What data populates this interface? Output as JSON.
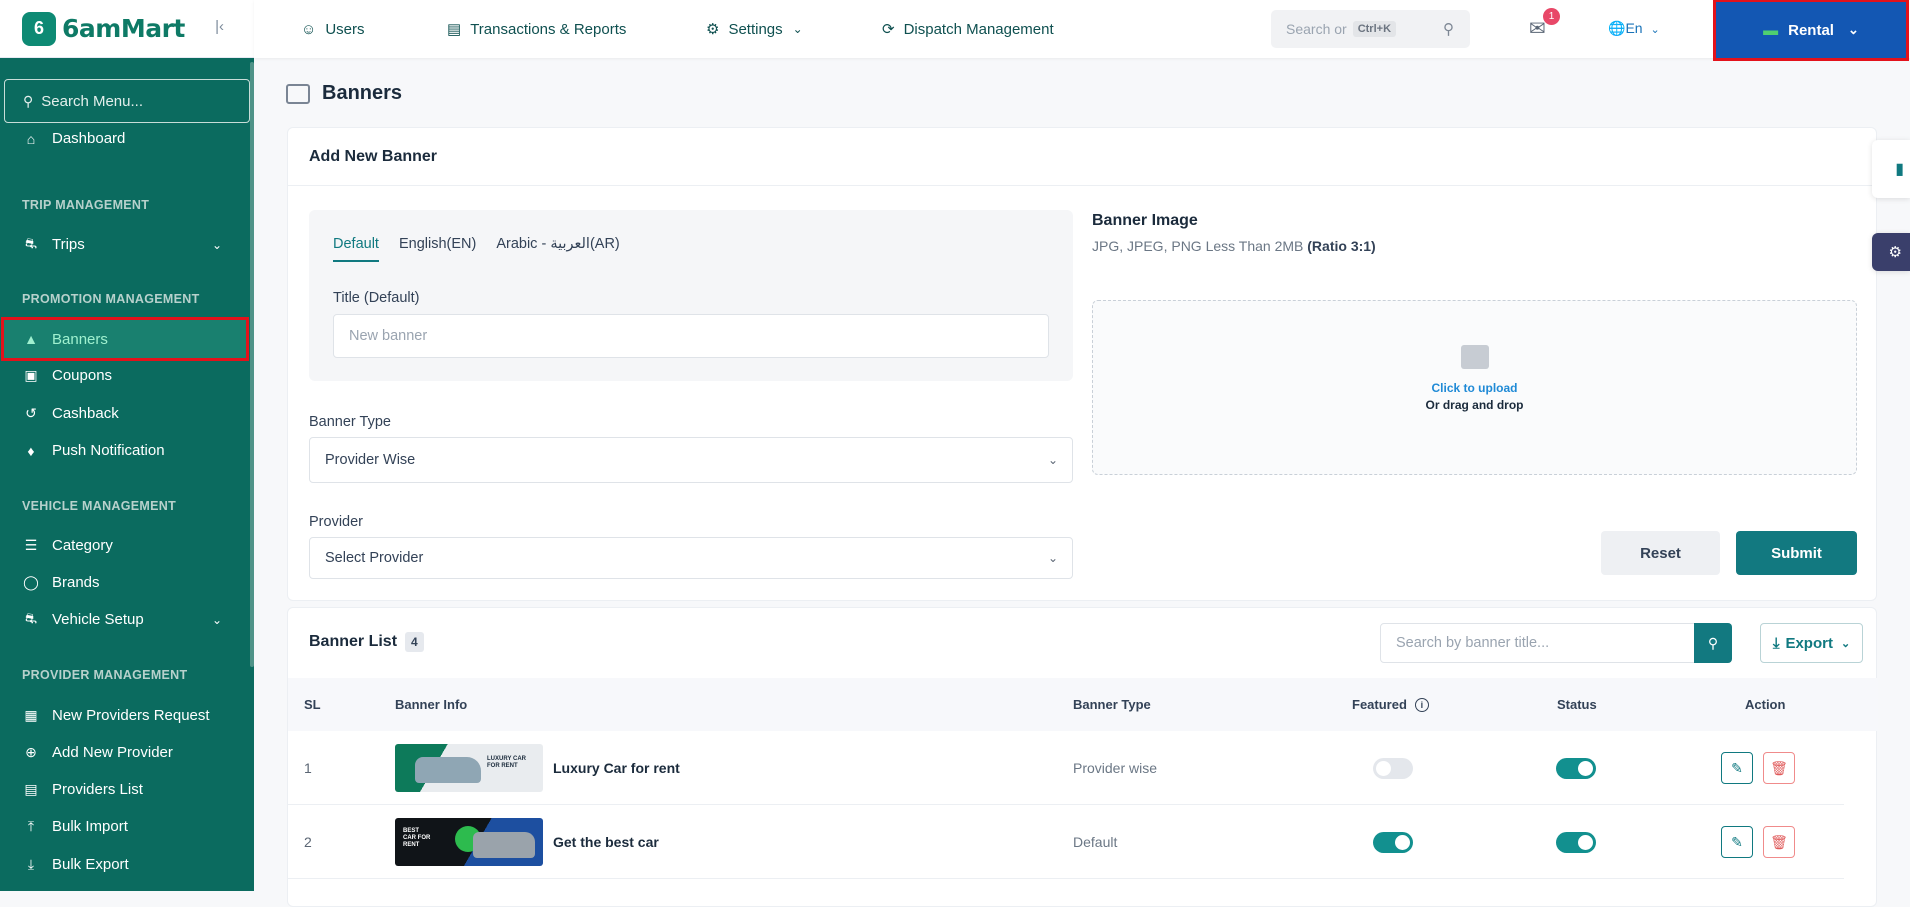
{
  "brand": {
    "name": "6amMart",
    "mark": "6"
  },
  "sidebar": {
    "search_placeholder": "Search Menu...",
    "dashboard": "Dashboard",
    "sections": {
      "trip": "TRIP MANAGEMENT",
      "promotion": "PROMOTION MANAGEMENT",
      "vehicle": "VEHICLE MANAGEMENT",
      "provider": "PROVIDER MANAGEMENT"
    },
    "items": {
      "trips": "Trips",
      "banners": "Banners",
      "coupons": "Coupons",
      "cashback": "Cashback",
      "push": "Push Notification",
      "category": "Category",
      "brands": "Brands",
      "vehicle_setup": "Vehicle Setup",
      "new_providers": "New Providers Request",
      "add_provider": "Add New Provider",
      "providers_list": "Providers List",
      "bulk_import": "Bulk Import",
      "bulk_export": "Bulk Export"
    }
  },
  "topbar": {
    "users": "Users",
    "transactions": "Transactions & Reports",
    "settings": "Settings",
    "dispatch": "Dispatch Management",
    "search_placeholder": "Search or",
    "shortcut": "Ctrl+K",
    "notif_count": "1",
    "lang": "En",
    "module": "Rental"
  },
  "page": {
    "title": "Banners"
  },
  "form": {
    "header": "Add New Banner",
    "tabs": [
      "Default",
      "English(EN)",
      "Arabic - العربية(AR)"
    ],
    "title_label": "Title (Default)",
    "title_placeholder": "New banner",
    "type_label": "Banner Type",
    "type_value": "Provider Wise",
    "provider_label": "Provider",
    "provider_value": "Select Provider",
    "image_label": "Banner Image",
    "image_hint": "JPG, JPEG, PNG Less Than 2MB",
    "image_ratio": "(Ratio 3:1)",
    "upload_link": "Click to upload",
    "upload_hint": "Or drag and drop",
    "reset": "Reset",
    "submit": "Submit"
  },
  "list": {
    "title": "Banner List",
    "count": "4",
    "search_placeholder": "Search by banner title...",
    "export": "Export",
    "columns": {
      "sl": "SL",
      "info": "Banner Info",
      "type": "Banner Type",
      "featured": "Featured",
      "status": "Status",
      "action": "Action"
    },
    "rows": [
      {
        "sl": "1",
        "title": "Luxury Car for rent",
        "type": "Provider wise",
        "featured": false,
        "status": true,
        "thumb_text": "LUXURY CAR FOR RENT"
      },
      {
        "sl": "2",
        "title": "Get the best car",
        "type": "Default",
        "featured": true,
        "status": true,
        "thumb_text": "BEST CAR FOR RENT"
      }
    ]
  },
  "colors": {
    "sidebar": "#0b6b5f",
    "accent": "#107980",
    "module": "#1357b3",
    "highlight": "#e3121b"
  }
}
